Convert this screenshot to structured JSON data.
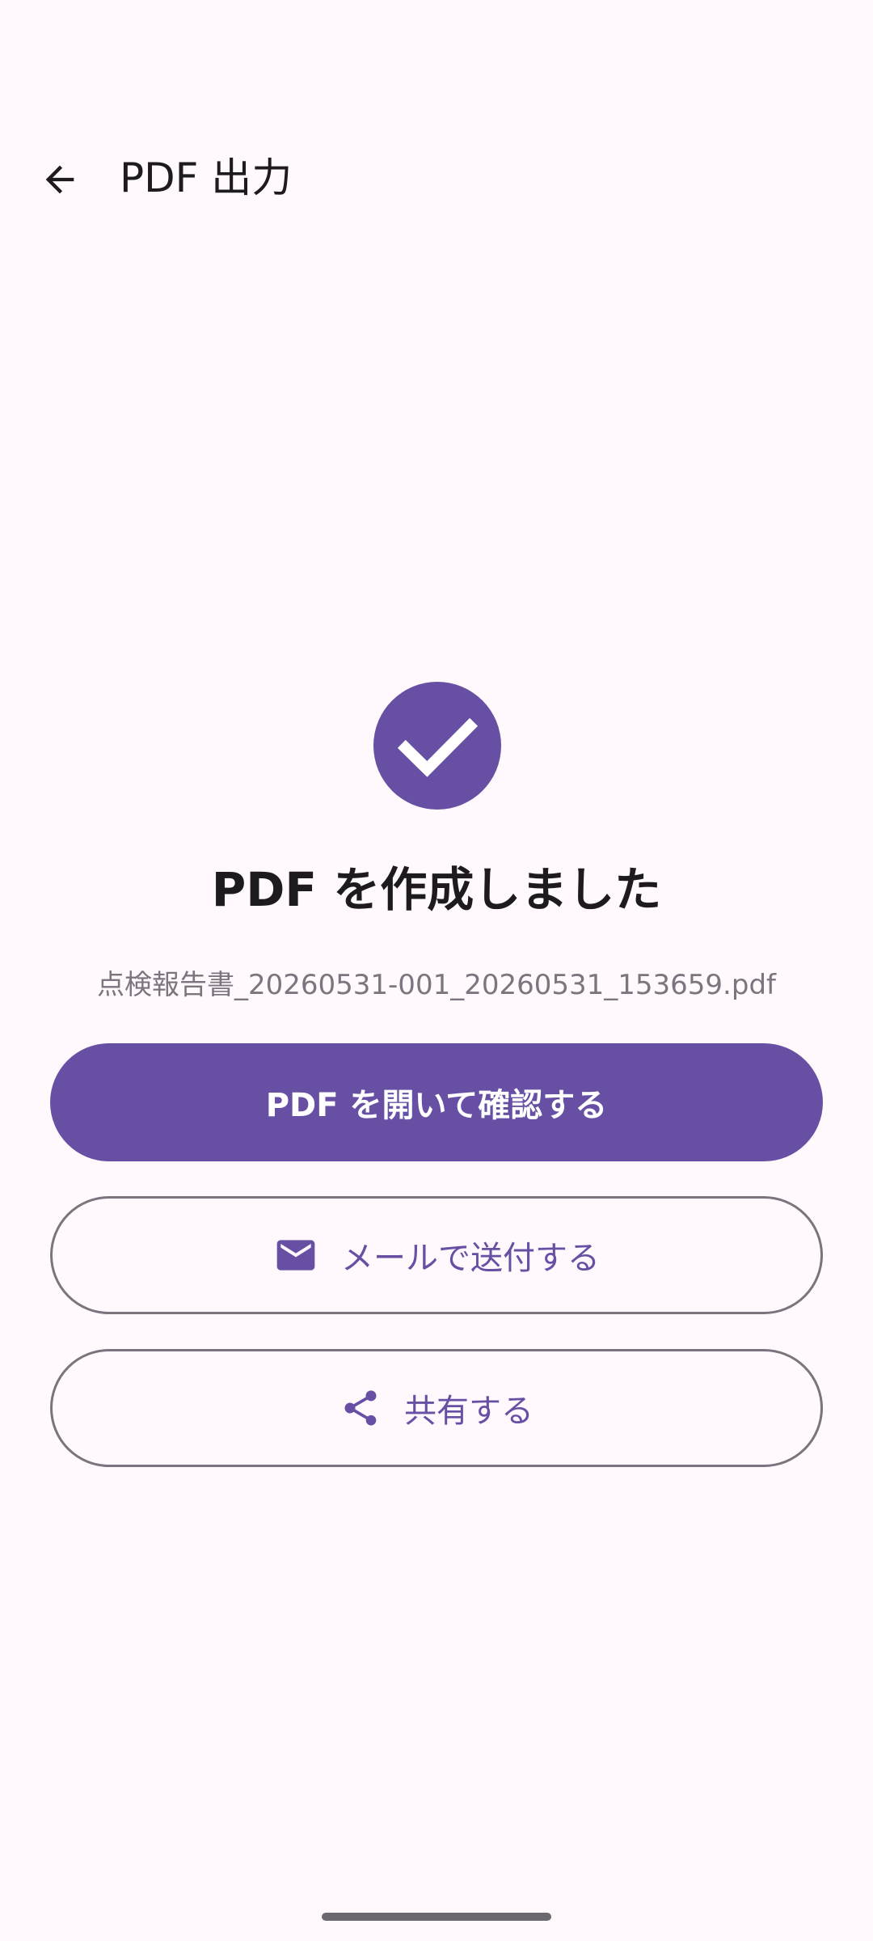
{
  "app_bar": {
    "back_icon": "arrow-back-icon",
    "title": "PDF 出力"
  },
  "result": {
    "icon": "check-circle-icon",
    "headline": "PDF を作成しました",
    "filename": "点検報告書_20260531-001_20260531_153659.pdf"
  },
  "actions": {
    "open_label": "PDF を開いて確認する",
    "mail_label": "メールで送付する",
    "mail_icon": "mail-icon",
    "share_label": "共有する",
    "share_icon": "share-icon"
  },
  "colors": {
    "background": "#FFF8FC",
    "primary": "#6750A4",
    "on_surface": "#1D1B20",
    "outline": "#79747E",
    "secondary_text": "#7A757F"
  }
}
